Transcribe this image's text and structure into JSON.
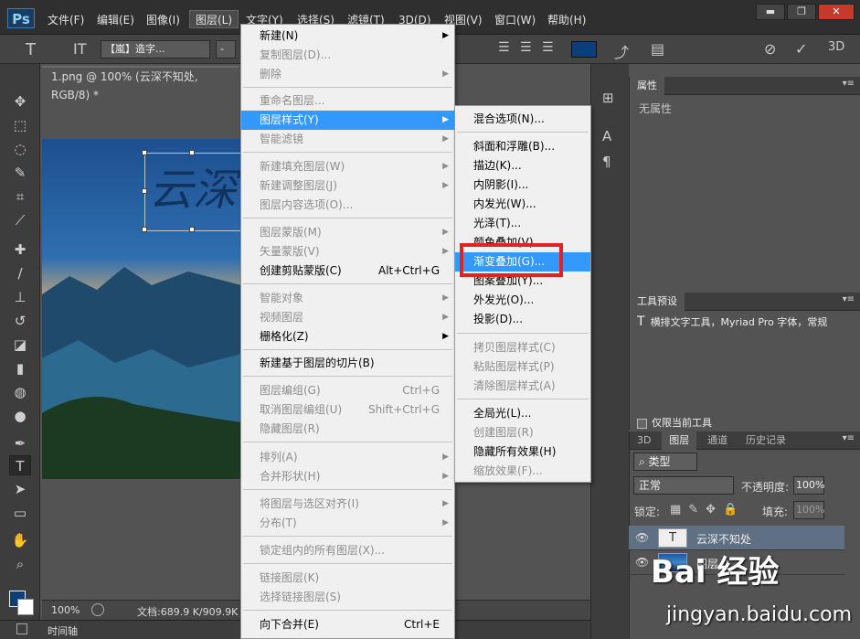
{
  "app": {
    "logo": "Ps"
  },
  "menubar": {
    "items": [
      "文件(F)",
      "编辑(E)",
      "图像(I)",
      "图层(L)",
      "文字(Y)",
      "选择(S)",
      "滤镜(T)",
      "3D(D)",
      "视图(V)",
      "窗口(W)",
      "帮助(H)"
    ],
    "window_buttons": [
      "▬",
      "❐",
      "✕"
    ]
  },
  "options_bar": {
    "tool_icon": "T",
    "orient_icon": "IT",
    "font_family": "【嵐】造字...",
    "font_size": "-",
    "three_d": "3D"
  },
  "document": {
    "tab_title": "1.png @ 100% (云深不知处, RGB/8) *",
    "canvas_text": "云深"
  },
  "status": {
    "zoom": "100%",
    "doc_info": "文档:689.9 K/909.9K"
  },
  "timeline": {
    "label": "时间轴"
  },
  "properties_panel": {
    "tab": "属性",
    "empty_text": "无属性"
  },
  "tool_presets_panel": {
    "tab": "工具预设",
    "item_text": "横排文字工具，Myriad Pro 字体，常规",
    "current_tool_only": "仅限当前工具"
  },
  "layers_panel": {
    "tabs": [
      "3D",
      "图层",
      "通道",
      "历史记录"
    ],
    "filter_label": "类型",
    "blend_mode": "正常",
    "opacity_label": "不透明度:",
    "opacity_value": "100%",
    "lock_label": "锁定:",
    "fill_label": "填充:",
    "fill_value": "100%",
    "layers": [
      {
        "name": "云深不知处",
        "thumb": "T",
        "selected": true
      },
      {
        "name": "图层 0",
        "thumb": "",
        "selected": false
      }
    ]
  },
  "layer_menu": {
    "items": [
      {
        "label": "新建(N)",
        "shortcut": "",
        "submenu": true,
        "disabled": false
      },
      {
        "label": "复制图层(D)...",
        "shortcut": "",
        "submenu": false,
        "disabled": true
      },
      {
        "label": "删除",
        "shortcut": "",
        "submenu": true,
        "disabled": true
      },
      {
        "label": "重命名图层...",
        "shortcut": "",
        "submenu": false,
        "disabled": true
      },
      {
        "label": "图层样式(Y)",
        "shortcut": "",
        "submenu": true,
        "disabled": false,
        "highlight": true
      },
      {
        "label": "智能滤镜",
        "shortcut": "",
        "submenu": true,
        "disabled": true
      },
      {
        "label": "新建填充图层(W)",
        "shortcut": "",
        "submenu": true,
        "disabled": true
      },
      {
        "label": "新建调整图层(J)",
        "shortcut": "",
        "submenu": true,
        "disabled": true
      },
      {
        "label": "图层内容选项(O)...",
        "shortcut": "",
        "submenu": false,
        "disabled": true
      },
      {
        "label": "图层蒙版(M)",
        "shortcut": "",
        "submenu": true,
        "disabled": true
      },
      {
        "label": "矢量蒙版(V)",
        "shortcut": "",
        "submenu": true,
        "disabled": true
      },
      {
        "label": "创建剪贴蒙版(C)",
        "shortcut": "Alt+Ctrl+G",
        "submenu": false,
        "disabled": false
      },
      {
        "label": "智能对象",
        "shortcut": "",
        "submenu": true,
        "disabled": true
      },
      {
        "label": "视频图层",
        "shortcut": "",
        "submenu": true,
        "disabled": true
      },
      {
        "label": "栅格化(Z)",
        "shortcut": "",
        "submenu": true,
        "disabled": false
      },
      {
        "label": "新建基于图层的切片(B)",
        "shortcut": "",
        "submenu": false,
        "disabled": false
      },
      {
        "label": "图层编组(G)",
        "shortcut": "Ctrl+G",
        "submenu": false,
        "disabled": true
      },
      {
        "label": "取消图层编组(U)",
        "shortcut": "Shift+Ctrl+G",
        "submenu": false,
        "disabled": true
      },
      {
        "label": "隐藏图层(R)",
        "shortcut": "",
        "submenu": false,
        "disabled": true
      },
      {
        "label": "排列(A)",
        "shortcut": "",
        "submenu": true,
        "disabled": true
      },
      {
        "label": "合并形状(H)",
        "shortcut": "",
        "submenu": true,
        "disabled": true
      },
      {
        "label": "将图层与选区对齐(I)",
        "shortcut": "",
        "submenu": true,
        "disabled": true
      },
      {
        "label": "分布(T)",
        "shortcut": "",
        "submenu": true,
        "disabled": true
      },
      {
        "label": "锁定组内的所有图层(X)...",
        "shortcut": "",
        "submenu": false,
        "disabled": true
      },
      {
        "label": "链接图层(K)",
        "shortcut": "",
        "submenu": false,
        "disabled": true
      },
      {
        "label": "选择链接图层(S)",
        "shortcut": "",
        "submenu": false,
        "disabled": true
      },
      {
        "label": "向下合并(E)",
        "shortcut": "Ctrl+E",
        "submenu": false,
        "disabled": false
      }
    ]
  },
  "style_submenu": {
    "items": [
      {
        "label": "混合选项(N)...",
        "disabled": false
      },
      {
        "label": "斜面和浮雕(B)...",
        "disabled": false
      },
      {
        "label": "描边(K)...",
        "disabled": false
      },
      {
        "label": "内阴影(I)...",
        "disabled": false
      },
      {
        "label": "内发光(W)...",
        "disabled": false
      },
      {
        "label": "光泽(T)...",
        "disabled": false
      },
      {
        "label": "颜色叠加(V)...",
        "disabled": false
      },
      {
        "label": "渐变叠加(G)...",
        "disabled": false,
        "highlight": true
      },
      {
        "label": "图案叠加(Y)...",
        "disabled": false
      },
      {
        "label": "外发光(O)...",
        "disabled": false
      },
      {
        "label": "投影(D)...",
        "disabled": false
      },
      {
        "label": "拷贝图层样式(C)",
        "disabled": true
      },
      {
        "label": "粘贴图层样式(P)",
        "disabled": true
      },
      {
        "label": "清除图层样式(A)",
        "disabled": true
      },
      {
        "label": "全局光(L)...",
        "disabled": false
      },
      {
        "label": "创建图层(R)",
        "disabled": true
      },
      {
        "label": "隐藏所有效果(H)",
        "disabled": false
      },
      {
        "label": "缩放效果(F)...",
        "disabled": true
      }
    ]
  },
  "watermark": {
    "brand": "Bai 经验",
    "url": "jingyan.baidu.com"
  }
}
